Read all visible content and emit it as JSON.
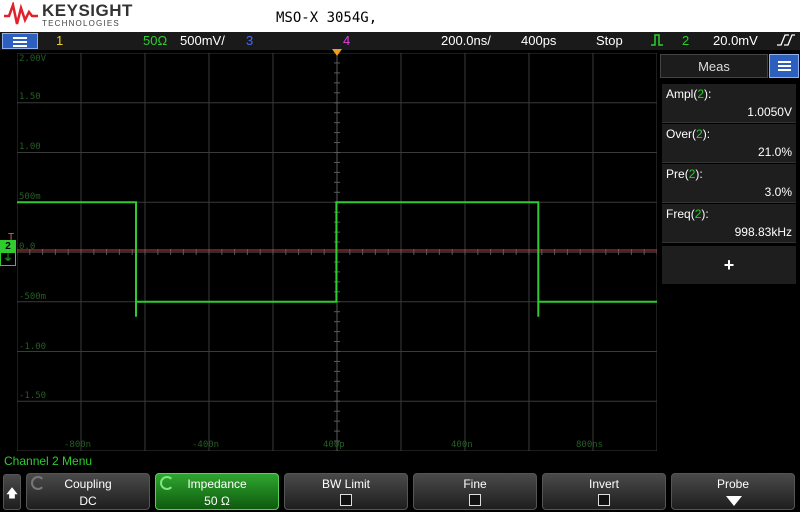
{
  "header": {
    "brand": "KEYSIGHT",
    "brand_sub": "TECHNOLOGIES",
    "model": "MSO-X 3054G,"
  },
  "status": {
    "ch1": "1",
    "ch2_impedance": "50Ω",
    "ch2_scale": "500mV/",
    "ch3": "3",
    "ch4": "4",
    "timebase": "200.0ns/",
    "delay": "400ps",
    "run_state": "Stop",
    "trigger_source": "2",
    "trigger_level": "20.0mV",
    "colors": {
      "ch1": "#f0d020",
      "ch2": "#2ecc2e",
      "ch3": "#4a6cf0",
      "ch4": "#e040e0"
    }
  },
  "screen": {
    "y_labels": [
      "2.00V",
      "1.50",
      "1.00",
      "500m",
      "0.0",
      "-500m",
      "-1.00",
      "-1.50"
    ],
    "x_labels": [
      "-800n",
      "-400n",
      "400p",
      "400n",
      "800ns"
    ],
    "channel_marker": "2",
    "trigger_marker": "T"
  },
  "chart_data": {
    "type": "line",
    "series": [
      {
        "x": [
          -1000,
          -628,
          -628,
          -628,
          -2,
          -2,
          629,
          629,
          629,
          1000
        ],
        "y": [
          0.5,
          0.5,
          -0.65,
          -0.5,
          -0.5,
          0.5,
          0.5,
          -0.65,
          -0.5,
          -0.5
        ]
      }
    ],
    "xlim": [
      -1000,
      1000
    ],
    "ylim": [
      -2,
      2
    ],
    "grid": true,
    "xunit": "ns",
    "yunit": "V"
  },
  "side_panel": {
    "tab_label": "Meas",
    "measurements": [
      {
        "name": "Ampl",
        "channel": "2",
        "value": "1.0050V"
      },
      {
        "name": "Over",
        "channel": "2",
        "value": "21.0%"
      },
      {
        "name": "Pre",
        "channel": "2",
        "value": "3.0%"
      },
      {
        "name": "Freq",
        "channel": "2",
        "value": "998.83kHz"
      }
    ],
    "add_label": "+"
  },
  "menu": {
    "title": "Channel 2 Menu",
    "softkeys": [
      {
        "label": "Coupling",
        "value": "DC"
      },
      {
        "label": "Impedance",
        "value": "50 Ω"
      },
      {
        "label": "BW Limit"
      },
      {
        "label": "Fine"
      },
      {
        "label": "Invert"
      },
      {
        "label": "Probe"
      }
    ]
  }
}
